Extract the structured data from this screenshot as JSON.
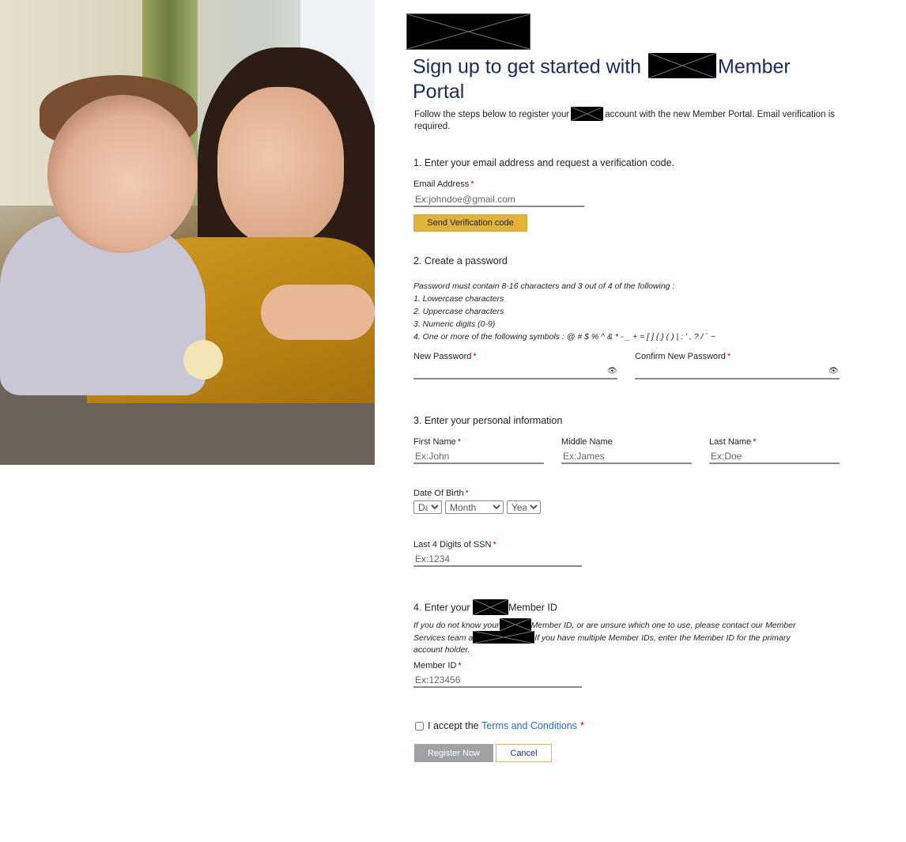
{
  "header": {
    "title_part1": "Sign up to get started with",
    "title_part2": "Member Portal",
    "intro_part1": "Follow the steps below to register your",
    "intro_part2": "account with the new Member Portal. Email verification is required."
  },
  "step1": {
    "heading": "1. Enter your email address and request a verification code.",
    "email_label": "Email Address",
    "email_placeholder": "Ex:johndoe@gmail.com",
    "send_button": "Send Verification code"
  },
  "step2": {
    "heading": "2. Create a password",
    "rules": [
      "Password must contain 8-16 characters and 3 out of 4 of the following :",
      "1. Lowercase characters",
      "2. Uppercase characters",
      "3. Numeric digits (0-9)",
      "4. One or more of the following symbols : @ # $ % ^ & * - _ + = [ ] { } ( ) | : ' , ? / ` ~"
    ],
    "new_password_label": "New Password",
    "confirm_password_label": "Confirm New Password",
    "eye_icon_glyph": "👁"
  },
  "step3": {
    "heading": "3. Enter your personal information",
    "first_name_label": "First Name",
    "first_name_placeholder": "Ex:John",
    "middle_name_label": "Middle Name",
    "middle_name_placeholder": "Ex:James",
    "last_name_label": "Last Name",
    "last_name_placeholder": "Ex:Doe",
    "dob_label": "Date Of Birth",
    "dob_day": "Day",
    "dob_month": "Month",
    "dob_year": "Year",
    "ssn_label": "Last 4 Digits of SSN",
    "ssn_placeholder": "Ex:1234"
  },
  "step4": {
    "heading_part1": "4. Enter your",
    "heading_part2": "Member ID",
    "note_part1": "If you do not know your",
    "note_part2": "Member ID, or are unsure which one to use, please contact our Member Services team a",
    "note_part3": "If you have multiple Member IDs, enter the Member ID for the primary account holder.",
    "member_id_label": "Member ID",
    "member_id_placeholder": "Ex:123456"
  },
  "terms": {
    "prefix": "I accept the",
    "link": "Terms and Conditions"
  },
  "actions": {
    "register": "Register Now",
    "cancel": "Cancel"
  },
  "required_mark": "*",
  "colors": {
    "title": "#1b2a5e",
    "accent_yellow": "#e2b33c",
    "required": "#cc0000",
    "link": "#2a6ac8",
    "disabled_button": "#9ea1a6"
  }
}
